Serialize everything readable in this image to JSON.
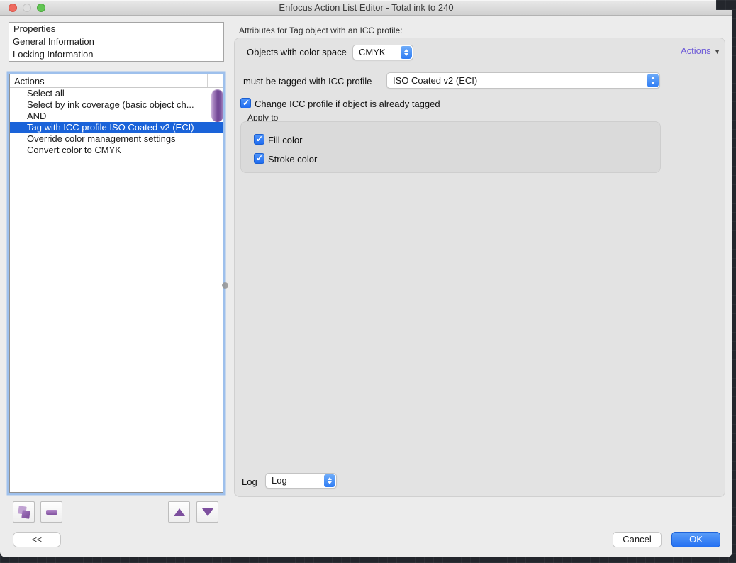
{
  "window": {
    "title": "Enfocus Action List Editor - Total ink to 240"
  },
  "left": {
    "properties": {
      "header": "Properties",
      "items": [
        {
          "label": "General Information"
        },
        {
          "label": "Locking Information"
        }
      ]
    },
    "actions": {
      "header": "Actions",
      "items": [
        {
          "label": "Select all",
          "selected": false
        },
        {
          "label": "Select by ink coverage (basic object ch...",
          "selected": false
        },
        {
          "label": "AND",
          "selected": false
        },
        {
          "label": "Tag with ICC profile ISO Coated v2 (ECI)",
          "selected": true
        },
        {
          "label": "Override color management settings",
          "selected": false
        },
        {
          "label": "Convert color to CMYK",
          "selected": false
        }
      ]
    },
    "toolbar": {
      "collapse_label": "<<"
    }
  },
  "right": {
    "header": "Attributes for Tag object with an ICC profile:",
    "actions_menu": {
      "label": "Actions",
      "arrow": "▼"
    },
    "color_space": {
      "label": "Objects with color space",
      "value": "CMYK"
    },
    "icc_profile": {
      "label": "must be tagged with ICC profile",
      "value": "ISO Coated v2 (ECI)"
    },
    "change_profile": {
      "label": "Change ICC profile if object is already tagged",
      "checked": true
    },
    "apply_to": {
      "label": "Apply to",
      "options": [
        {
          "label": "Fill color",
          "checked": true
        },
        {
          "label": "Stroke color",
          "checked": true
        }
      ]
    },
    "log": {
      "label": "Log",
      "value": "Log"
    }
  },
  "footer": {
    "cancel_label": "Cancel",
    "ok_label": "OK"
  },
  "icons": {
    "traffic_lights": [
      "close",
      "minimize",
      "zoom"
    ],
    "list_buttons": [
      "duplicate-action",
      "remove-action",
      "move-up",
      "move-down"
    ],
    "check_glyph": "✓"
  },
  "colors": {
    "selection_blue": "#1a63d9",
    "control_blue": "#2e7cf4",
    "enfocus_purple": "#7d4f9e",
    "link_purple": "#6e5bd8",
    "panel_gray": "#e3e3e3",
    "desktop_dark": "#23262c"
  }
}
